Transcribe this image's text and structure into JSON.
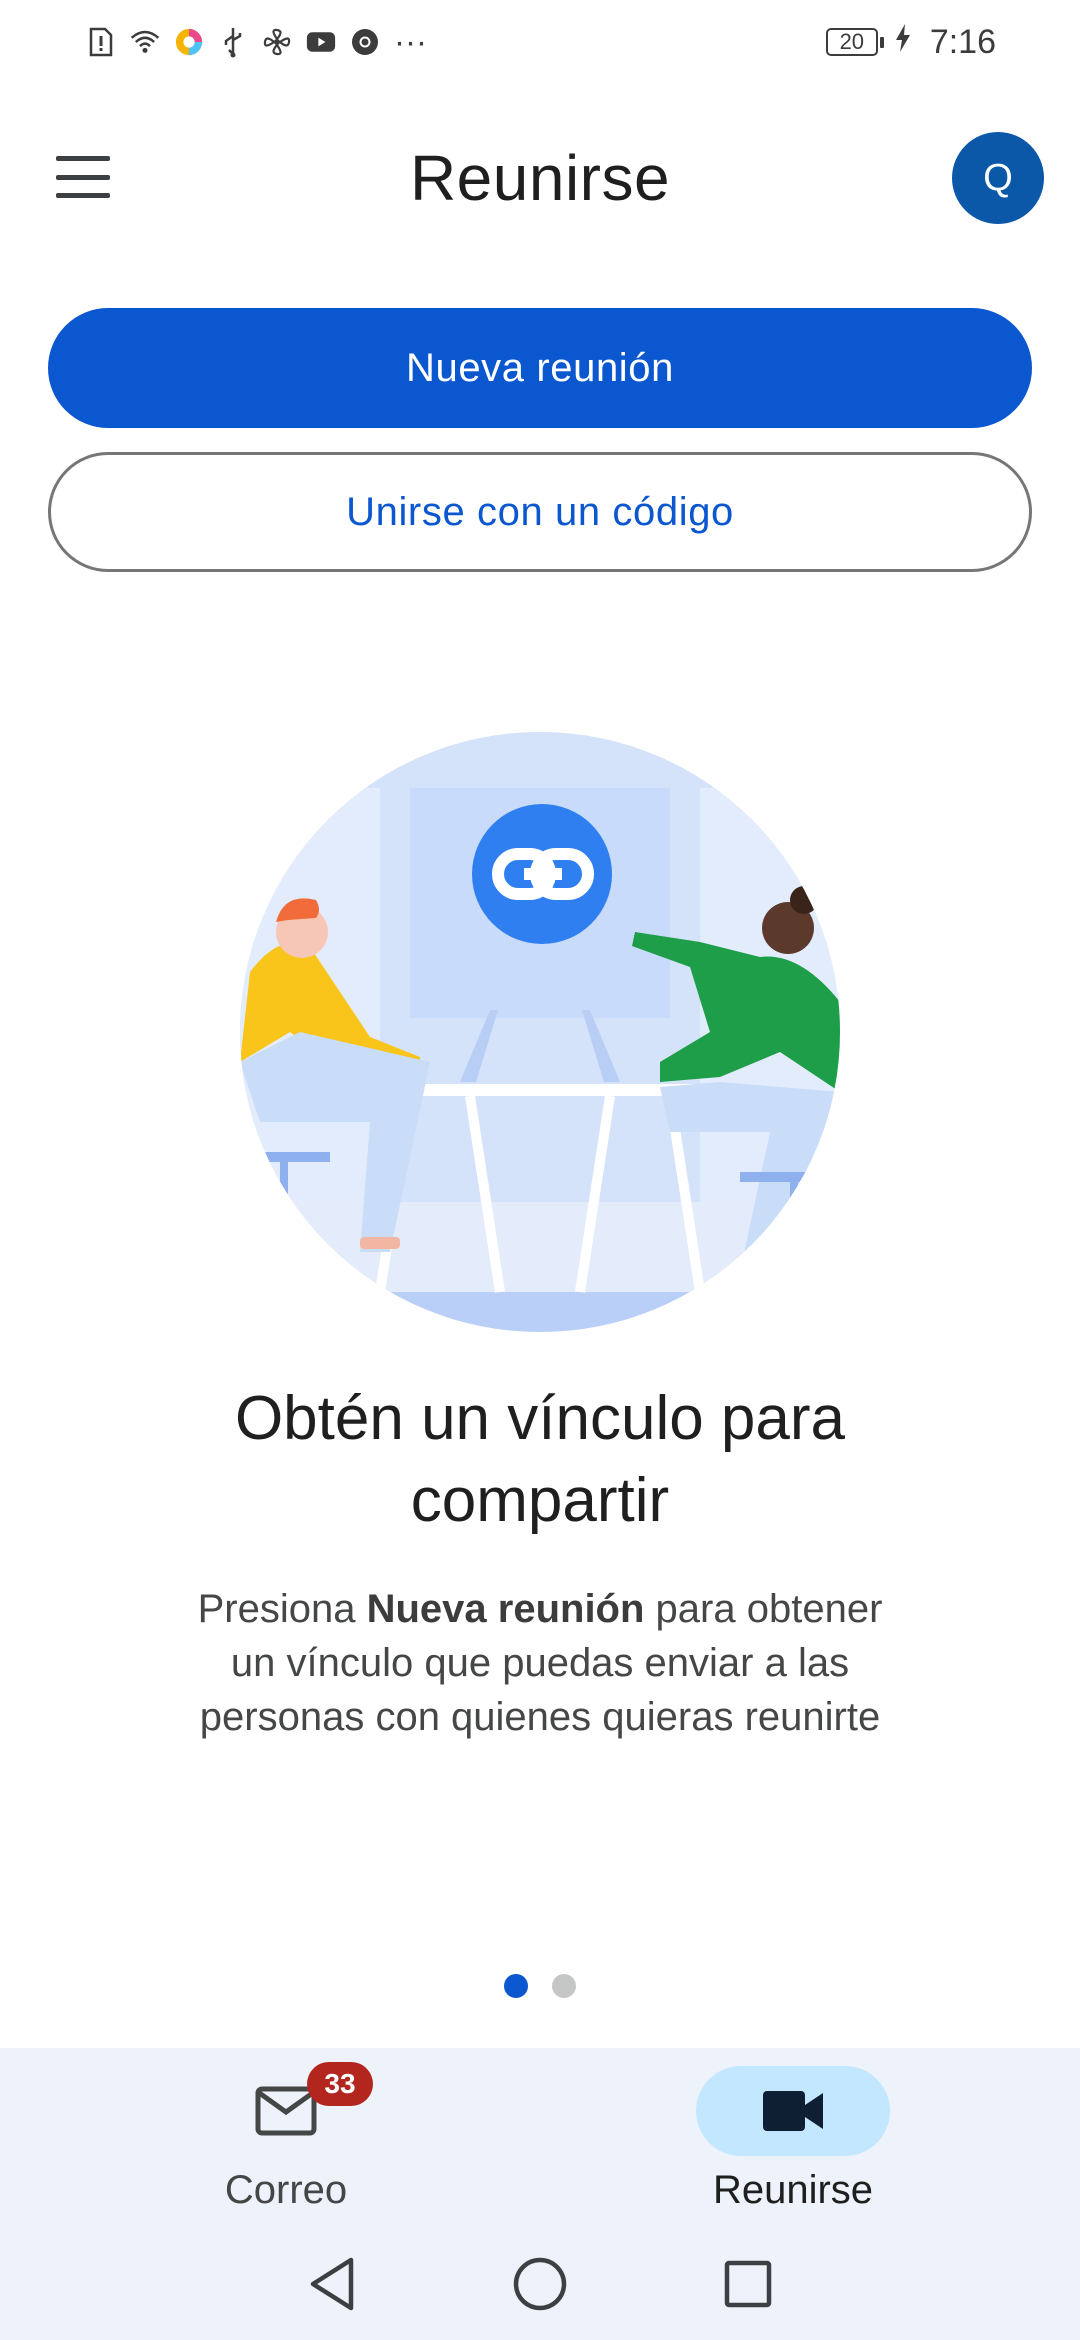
{
  "status_bar": {
    "battery": "20",
    "time": "7:16",
    "more_indicator": "···"
  },
  "app_bar": {
    "title": "Reunirse",
    "avatar_initial": "Q"
  },
  "actions": {
    "new_meeting": "Nueva reunión",
    "join_with_code": "Unirse con un código"
  },
  "onboarding": {
    "headline": "Obtén un vínculo para compartir",
    "body_prefix": "Presiona ",
    "body_bold": "Nueva reunión",
    "body_suffix": " para obtener un vínculo que puedas enviar a las personas con quienes quieras reunirte",
    "page_count": 2,
    "active_page": 1
  },
  "bottom_nav": {
    "items": [
      {
        "label": "Correo",
        "icon": "mail-icon",
        "badge": "33",
        "selected": false
      },
      {
        "label": "Reunirse",
        "icon": "video-camera-icon",
        "selected": true
      }
    ]
  },
  "colors": {
    "primary": "#0b57d0",
    "avatar_bg": "#0b57a8",
    "nav_bg": "#eef2fa",
    "nav_selected_pill": "#c2e7ff",
    "badge": "#b3261e"
  }
}
